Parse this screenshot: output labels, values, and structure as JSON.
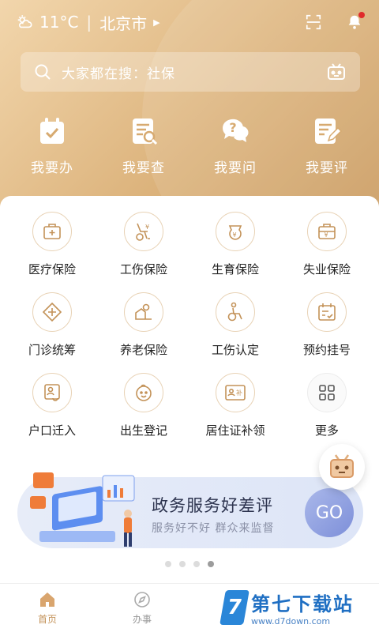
{
  "status": {
    "temperature": "11°C",
    "city": "北京市"
  },
  "search": {
    "placeholder": "大家都在搜：社保"
  },
  "top_actions": [
    {
      "label": "我要办",
      "icon": "calendar-check-icon"
    },
    {
      "label": "我要查",
      "icon": "document-search-icon"
    },
    {
      "label": "我要问",
      "icon": "question-chat-icon"
    },
    {
      "label": "我要评",
      "icon": "edit-document-icon"
    }
  ],
  "grid": [
    {
      "label": "医疗保险",
      "icon": "medical-insurance-icon"
    },
    {
      "label": "工伤保险",
      "icon": "injury-insurance-icon"
    },
    {
      "label": "生育保险",
      "icon": "maternity-insurance-icon"
    },
    {
      "label": "失业保险",
      "icon": "unemployment-insurance-icon"
    },
    {
      "label": "门诊统筹",
      "icon": "outpatient-icon"
    },
    {
      "label": "养老保险",
      "icon": "pension-icon"
    },
    {
      "label": "工伤认定",
      "icon": "injury-identification-icon"
    },
    {
      "label": "预约挂号",
      "icon": "appointment-icon"
    },
    {
      "label": "户口迁入",
      "icon": "household-transfer-icon"
    },
    {
      "label": "出生登记",
      "icon": "birth-registration-icon"
    },
    {
      "label": "居住证补领",
      "icon": "residence-permit-icon"
    },
    {
      "label": "更多",
      "icon": "more-grid-icon"
    }
  ],
  "banner": {
    "title": "政务服务好差评",
    "subtitle": "服务好不好  群众来监督",
    "go_label": "GO"
  },
  "carousel": {
    "count": 4,
    "active_index": 3
  },
  "tabbar": [
    {
      "label": "首页",
      "icon": "home-icon",
      "active": true
    },
    {
      "label": "办事",
      "icon": "compass-icon",
      "active": false
    }
  ],
  "watermark": {
    "logo": "7",
    "title": "第七下载站",
    "url": "www.d7down.com"
  },
  "colors": {
    "header_gradient_start": "#f2d6ac",
    "header_gradient_end": "#c8985c",
    "accent": "#c39258",
    "banner_go": "#7d8fd9",
    "notification_dot": "#e02a2a"
  }
}
